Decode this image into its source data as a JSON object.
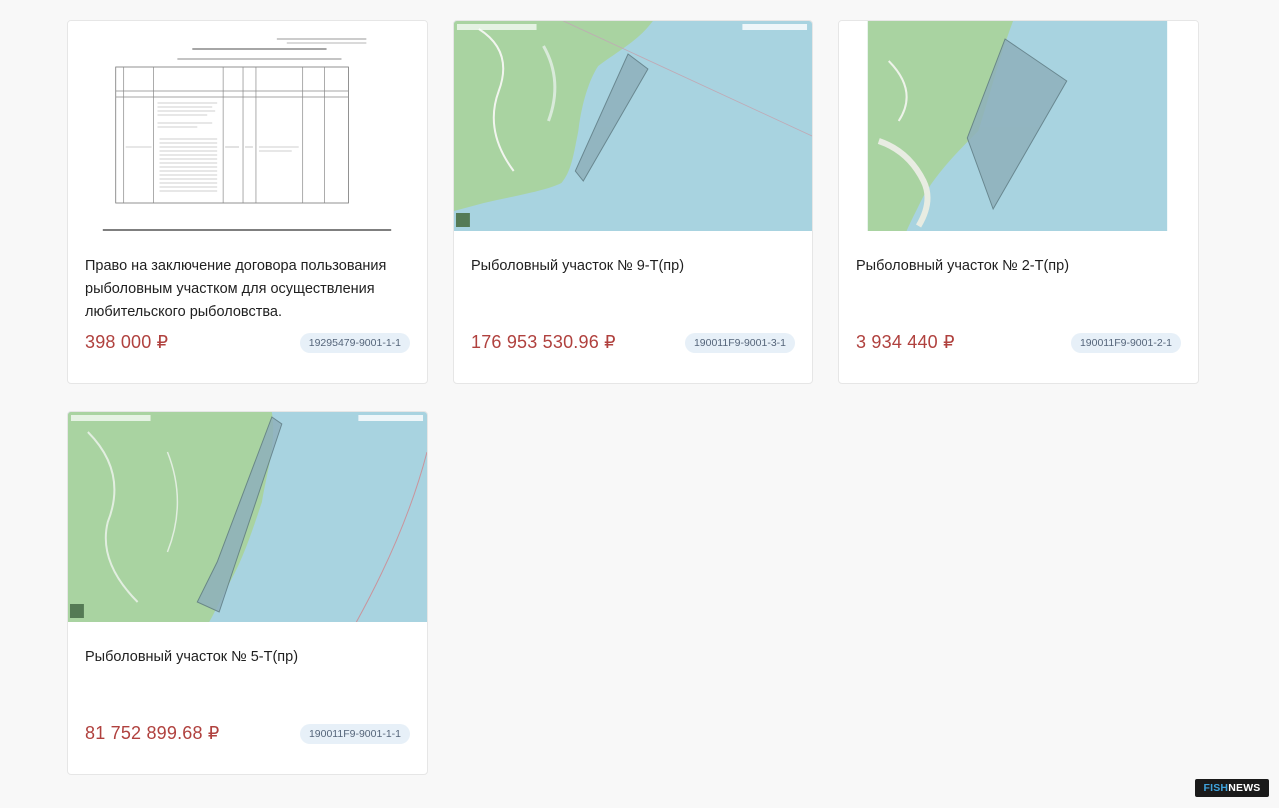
{
  "lots": [
    {
      "title": "Право на заключение договора пользования рыболовным участком для осуществления любительского рыболовства.",
      "price": "398 000 ₽",
      "lot_id": "19295479-9001-1-1",
      "image": "document-scan"
    },
    {
      "title": "Рыболовный участок № 9-Т(пр)",
      "price": "176 953 530.96 ₽",
      "lot_id": "190011F9-9001-3-1",
      "image": "map"
    },
    {
      "title": "Рыболовный участок № 2-Т(пр)",
      "price": "3 934 440 ₽",
      "lot_id": "190011F9-9001-2-1",
      "image": "map"
    },
    {
      "title": "Рыболовный участок № 5-Т(пр)",
      "price": "81 752 899.68 ₽",
      "lot_id": "190011F9-9001-1-1",
      "image": "map"
    }
  ],
  "watermark": {
    "part1": "FISH",
    "part2": "NEWS"
  },
  "colors": {
    "price": "#b0413e",
    "badge_bg": "#e7f0f8",
    "land": "#a9d3a1",
    "sea": "#a8d3e0",
    "polygon": "#8fb0bb"
  }
}
